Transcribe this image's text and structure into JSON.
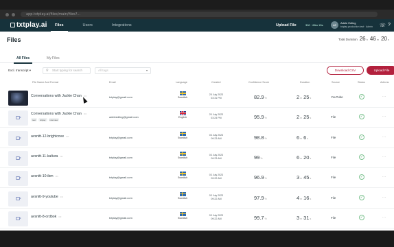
{
  "browser": {
    "url": "app.txtplay.ai/files/main/files?..."
  },
  "header": {
    "logo": "txtplay.ai",
    "nav": [
      {
        "label": "Files",
        "active": true
      },
      {
        "label": "Users",
        "active": false
      },
      {
        "label": "Integrations",
        "active": false
      }
    ],
    "upload_link": "Upload File",
    "duration_chip": "300 · 68m 15s",
    "user": {
      "initials": "AE",
      "name": "Adele Edling",
      "org": "txtplay production test · Admin"
    }
  },
  "page": {
    "title": "Files",
    "total_duration": {
      "label": "Total Duration",
      "h": "26",
      "m": "46",
      "s": "20"
    }
  },
  "subtabs": [
    {
      "label": "All Files",
      "active": true
    },
    {
      "label": "My Files",
      "active": false
    }
  ],
  "filters": {
    "scope": "Excl. transcript",
    "search_placeholder": "Start typing for search",
    "tags_placeholder": "All tags"
  },
  "buttons": {
    "download_csv": "Download CSV",
    "upload_file": "Upload File"
  },
  "columns": [
    "File Name And Format",
    "Email",
    "Language",
    "Created",
    "Confidence Score",
    "Duration",
    "Source",
    "Status",
    "Actions"
  ],
  "rows": [
    {
      "name": "Conversations with Jackie Chan",
      "thumb": "video",
      "tags": [],
      "email": "txtplay@gmail.com",
      "flag": "se",
      "language": "Swedish",
      "date": "25 July 2023",
      "time": "03:31 PM",
      "conf": "82.9",
      "dur_m": "2",
      "dur_s": "25",
      "source": "YouTube"
    },
    {
      "name": "Conversations with Jackie Chan",
      "thumb": "cam",
      "tags": [
        "test",
        "txtplay",
        "interview"
      ],
      "email": "adeleedling@gmail.com",
      "flag": "gb",
      "language": "English",
      "date": "20 July 2023",
      "time": "03:24 PM",
      "conf": "95.9",
      "dur_m": "2",
      "dur_s": "25",
      "source": "File"
    },
    {
      "name": "avsnitt-12-brightcove",
      "thumb": "cam",
      "tags": [],
      "email": "txtplay@gmail.com",
      "flag": "se",
      "language": "Swedish",
      "date": "03 July 2023",
      "time": "09:23 AM",
      "conf": "98.8",
      "dur_m": "6",
      "dur_s": "6",
      "source": "File"
    },
    {
      "name": "avsnitt-11-kaltura",
      "thumb": "cam",
      "tags": [],
      "email": "txtplay@gmail.com",
      "flag": "se",
      "language": "Swedish",
      "date": "03 July 2023",
      "time": "09:23 AM",
      "conf": "99",
      "dur_m": "6",
      "dur_s": "20",
      "source": "File"
    },
    {
      "name": "avsnitt-10-ibm",
      "thumb": "cam",
      "tags": [],
      "email": "txtplay@gmail.com",
      "flag": "se",
      "language": "Swedish",
      "date": "03 July 2023",
      "time": "09:22 AM",
      "conf": "96.9",
      "dur_m": "3",
      "dur_s": "45",
      "source": "File"
    },
    {
      "name": "avsnitt-9-youtube",
      "thumb": "cam",
      "tags": [],
      "email": "txtplay@gmail.com",
      "flag": "se",
      "language": "Swedish",
      "date": "03 July 2023",
      "time": "09:22 AM",
      "conf": "97.9",
      "dur_m": "4",
      "dur_s": "16",
      "source": "File"
    },
    {
      "name": "avsnitt-8-ordbok",
      "thumb": "cam",
      "tags": [],
      "email": "txtplay@gmail.com",
      "flag": "se",
      "language": "Swedish",
      "date": "03 July 2023",
      "time": "09:22 AM",
      "conf": "99.7",
      "dur_m": "3",
      "dur_s": "31",
      "source": "File"
    }
  ],
  "units": {
    "percent": "%",
    "minutes": "m",
    "seconds": "s",
    "hours": "h"
  },
  "icons": {
    "status": "check-circle-icon",
    "actions": "more-icon"
  }
}
